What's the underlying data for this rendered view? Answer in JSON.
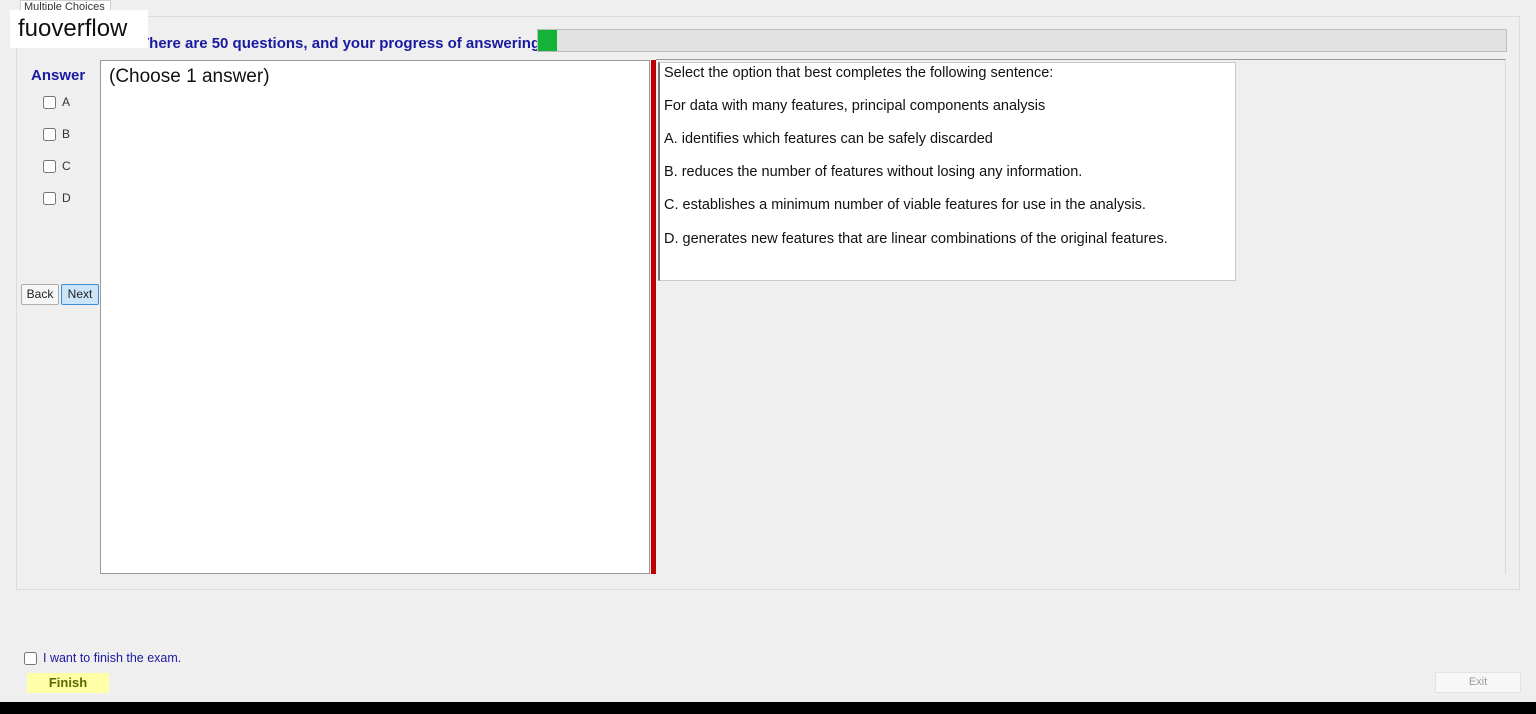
{
  "window": {
    "tab_title": "Multiple Choices",
    "watermark": "fuoverflow"
  },
  "progress": {
    "text": "There are 50 questions, and your progress of answering is",
    "fraction": 0.02,
    "fill_color": "#13b33a"
  },
  "answer_panel": {
    "heading": "Answer",
    "options": [
      "A",
      "B",
      "C",
      "D"
    ],
    "checked": [
      false,
      false,
      false,
      false
    ]
  },
  "nav": {
    "back_label": "Back",
    "next_label": "Next"
  },
  "left_panel": {
    "instruction": "(Choose 1 answer)"
  },
  "question": {
    "lines": [
      "Select the option that best completes the following sentence:",
      "For data with many features, principal components analysis",
      "A.  identifies which features can be safely discarded",
      "B.  reduces the number of features without losing any information.",
      "C.  establishes a minimum number of viable features for use in the analysis.",
      "D.  generates new features that are linear combinations of the original features."
    ]
  },
  "footer": {
    "finish_checkbox_label": "I want to finish the exam.",
    "finish_label": "Finish",
    "exit_label": "Exit"
  },
  "colors": {
    "accent_text": "#1a1aa0",
    "splitter": "#c00000",
    "finish_bg": "#ffffa8"
  }
}
